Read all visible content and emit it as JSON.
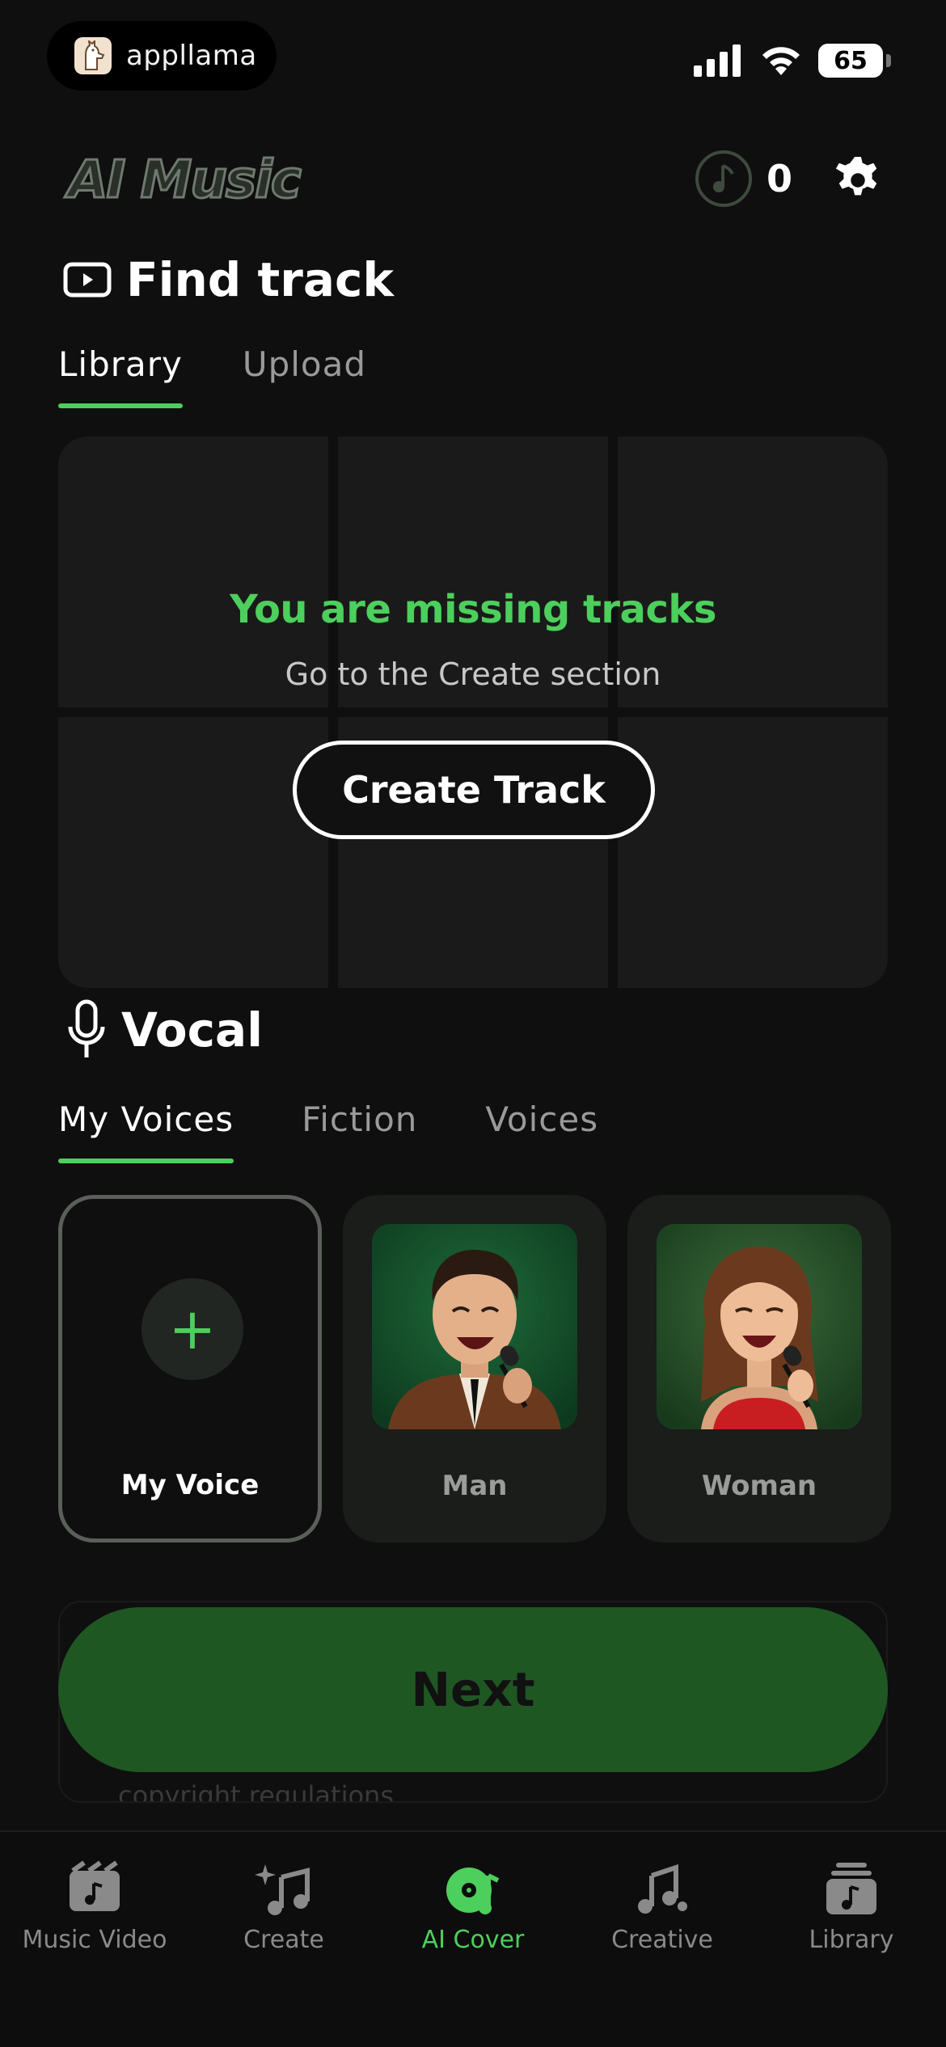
{
  "status": {
    "brand": "appllama",
    "battery": "65"
  },
  "header": {
    "app_title": "AI Music",
    "credits": "0"
  },
  "find": {
    "title": "Find track",
    "tabs": [
      "Library",
      "Upload"
    ],
    "empty_title": "You are missing tracks",
    "empty_sub": "Go to the Create section",
    "create_button": "Create Track"
  },
  "vocal": {
    "title": "Vocal",
    "tabs": [
      "My Voices",
      "Fiction",
      "Voices"
    ],
    "cards": [
      "My Voice",
      "Man",
      "Woman"
    ]
  },
  "next_button": "Next",
  "footer_note": "copyright regulations.",
  "nav": [
    "Music Video",
    "Create",
    "AI Cover",
    "Creative",
    "Library"
  ],
  "colors": {
    "accent": "#4ccf5c",
    "next_bg": "#1f5723",
    "bg": "#0f0f0f"
  }
}
